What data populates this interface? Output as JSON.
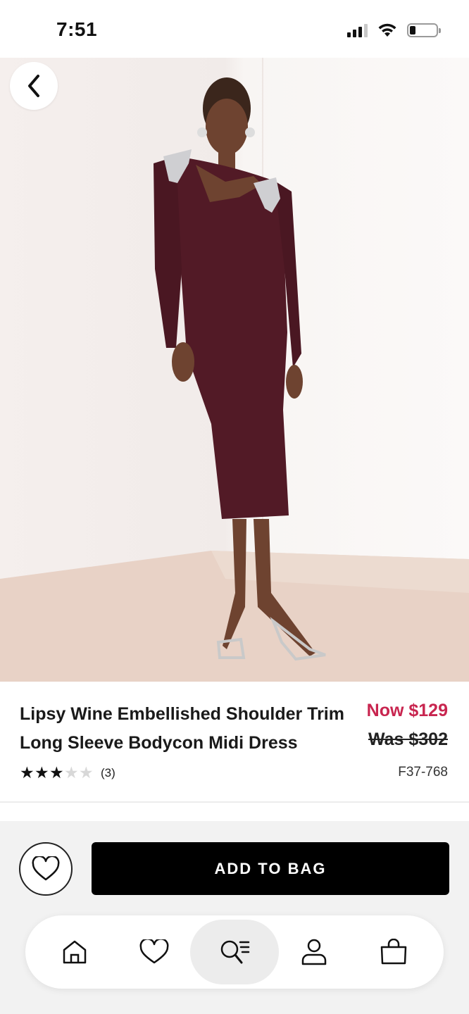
{
  "status_bar": {
    "time": "7:51"
  },
  "gallery": {
    "image_count": 4,
    "active_index": 0
  },
  "product": {
    "title": "Lipsy Wine Embellished Shoulder Trim Long Sleeve Bodycon Midi Dress",
    "price_now": "Now $129",
    "price_was": "Was $302",
    "rating": 3,
    "rating_max": 5,
    "review_count": "(3)",
    "sku": "F37-768"
  },
  "actions": {
    "add_to_bag_label": "ADD TO BAG"
  },
  "tabbar": {
    "items": [
      {
        "icon": "home-icon",
        "active": false
      },
      {
        "icon": "heart-icon",
        "active": false
      },
      {
        "icon": "search-icon",
        "active": true
      },
      {
        "icon": "account-icon",
        "active": false
      },
      {
        "icon": "bag-icon",
        "active": false
      }
    ]
  },
  "colors": {
    "accent_price": "#c8254f",
    "dress": "#521a26",
    "button": "#000000"
  }
}
